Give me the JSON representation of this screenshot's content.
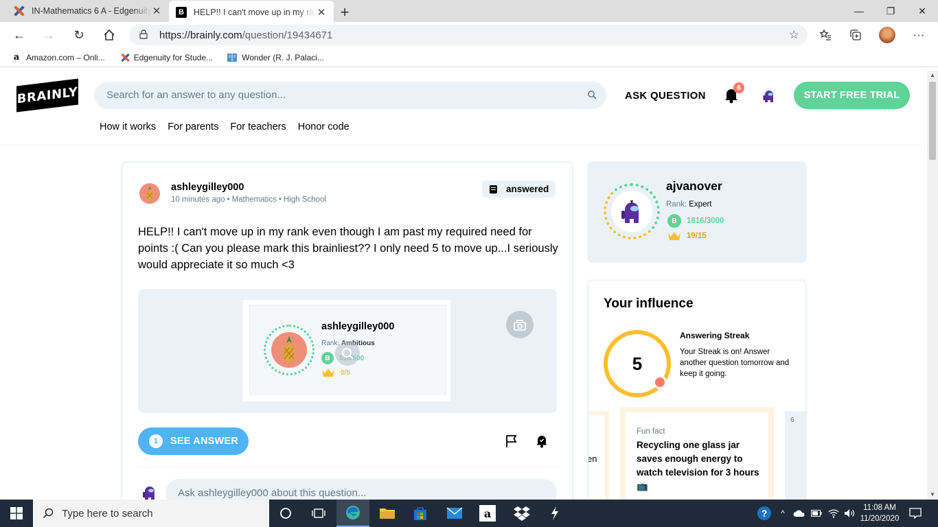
{
  "browser": {
    "tabs": [
      {
        "title": "IN-Mathematics 6 A - Edgenuity",
        "icon": "edgenuity-favicon",
        "active": false
      },
      {
        "title": "HELP!! I can't move up in my rank even though I am past",
        "icon": "brainly-favicon",
        "active": true
      }
    ],
    "url_host": "https://brainly.com",
    "url_path": "/question/19434671",
    "bookmarks": [
      {
        "label": "Amazon.com – Onli...",
        "icon": "amazon-favicon"
      },
      {
        "label": "Edgenuity for Stude...",
        "icon": "edgenuity-favicon"
      },
      {
        "label": "Wonder (R. J. Palaci...",
        "icon": "book-favicon"
      }
    ]
  },
  "header": {
    "logo": "BRAINLY",
    "search_placeholder": "Search for an answer to any question...",
    "ask_question": "ASK QUESTION",
    "notification_count": "6",
    "trial_button": "START FREE TRIAL",
    "subnav": [
      "How it works",
      "For parents",
      "For teachers",
      "Honor code"
    ]
  },
  "question": {
    "username": "ashleygilley000",
    "time": "10 minutes ago",
    "subject": "Mathematics",
    "level": "High School",
    "status": "answered",
    "text": "HELP!! I can't move up in my rank even though I am past my required need for points :( Can you please mark this brainliest?? I only need 5 to move up...I seriously would appreciate it so much <3",
    "attachment": {
      "username": "ashleygilley000",
      "rank_label": "Rank:",
      "rank": "Ambitious",
      "points": "518/500",
      "brainliest": "0/5"
    },
    "see_answer_count": "1",
    "see_answer_label": "SEE ANSWER",
    "comment_placeholder": "Ask ashleygilley000 about this question..."
  },
  "profile": {
    "username": "ajvanover",
    "rank_label": "Rank:",
    "rank": "Expert",
    "points": "1816/3000",
    "brainliest": "19/15"
  },
  "influence": {
    "title": "Your influence",
    "streak_count": "5",
    "streak_title": "Answering Streak",
    "streak_text": "Your Streak is on! Answer another question tomorrow and keep it going.",
    "left_card_fragment": "en",
    "fun_fact_label": "Fun fact",
    "fun_fact_text": "Recycling one glass jar saves enough energy to watch television for 3 hours",
    "right_card_number": "6"
  },
  "taskbar": {
    "search_placeholder": "Type here to search",
    "time": "11:08 AM",
    "date": "11/20/2020"
  },
  "colors": {
    "brand_green": "#60d399",
    "brand_blue": "#4fb3f6",
    "light_gray_blue": "#ebf2f7",
    "gold": "#fbbe2e",
    "notif_red": "#ff7968"
  }
}
